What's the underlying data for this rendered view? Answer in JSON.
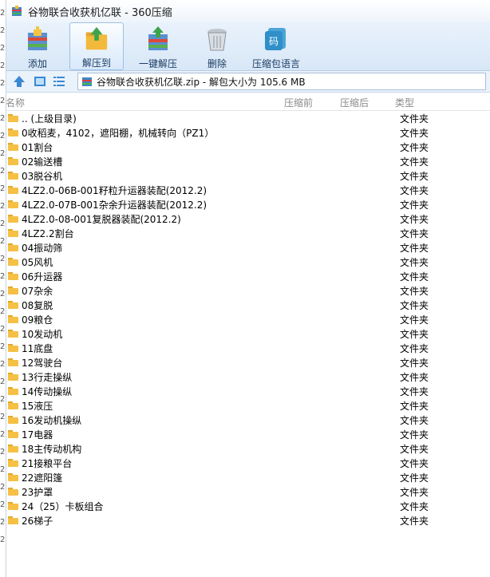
{
  "window": {
    "title": "谷物联合收获机亿联 - 360压缩"
  },
  "toolbar": {
    "add": "添加",
    "extract_to": "解压到",
    "one_click_extract": "一键解压",
    "delete": "删除",
    "language": "压缩包语言"
  },
  "path": {
    "text": "谷物联合收获机亿联.zip - 解包大小为 105.6 MB"
  },
  "columns": {
    "name": "名称",
    "compressed_before": "压缩前",
    "compressed_after": "压缩后",
    "type": "类型"
  },
  "left_edge_chars": [
    "2",
    "2",
    "2",
    "2",
    "2",
    "2",
    "2",
    "2",
    "2",
    "2",
    "2",
    "2",
    "2",
    "2",
    "2",
    "2",
    "2",
    "2",
    "2",
    "2",
    "2",
    "2",
    "2",
    "2",
    "2",
    "2",
    "2",
    "2",
    "2",
    "2",
    "2"
  ],
  "files": [
    {
      "name": ".. (上级目录)",
      "type": "文件夹"
    },
    {
      "name": "0收稻麦，4102，遮阳棚，机械转向（PZ1）",
      "type": "文件夹"
    },
    {
      "name": "01割台",
      "type": "文件夹"
    },
    {
      "name": "02输送槽",
      "type": "文件夹"
    },
    {
      "name": "03脱谷机",
      "type": "文件夹"
    },
    {
      "name": "4LZ2.0-06B-001籽粒升运器装配(2012.2)",
      "type": "文件夹"
    },
    {
      "name": "4LZ2.0-07B-001杂余升运器装配(2012.2)",
      "type": "文件夹"
    },
    {
      "name": "4LZ2.0-08-001复脱器装配(2012.2)",
      "type": "文件夹"
    },
    {
      "name": "4LZ2.2割台",
      "type": "文件夹"
    },
    {
      "name": "04振动筛",
      "type": "文件夹"
    },
    {
      "name": "05风机",
      "type": "文件夹"
    },
    {
      "name": "06升运器",
      "type": "文件夹"
    },
    {
      "name": "07杂余",
      "type": "文件夹"
    },
    {
      "name": "08复脱",
      "type": "文件夹"
    },
    {
      "name": "09粮仓",
      "type": "文件夹"
    },
    {
      "name": "10发动机",
      "type": "文件夹"
    },
    {
      "name": "11底盘",
      "type": "文件夹"
    },
    {
      "name": "12驾驶台",
      "type": "文件夹"
    },
    {
      "name": "13行走操纵",
      "type": "文件夹"
    },
    {
      "name": "14传动操纵",
      "type": "文件夹"
    },
    {
      "name": "15液压",
      "type": "文件夹"
    },
    {
      "name": "16发动机操纵",
      "type": "文件夹"
    },
    {
      "name": "17电器",
      "type": "文件夹"
    },
    {
      "name": "18主传动机构",
      "type": "文件夹"
    },
    {
      "name": "21接粮平台",
      "type": "文件夹"
    },
    {
      "name": "22遮阳篷",
      "type": "文件夹"
    },
    {
      "name": "23护罩",
      "type": "文件夹"
    },
    {
      "name": "24（25）卡板组合",
      "type": "文件夹"
    },
    {
      "name": "26梯子",
      "type": "文件夹"
    }
  ]
}
